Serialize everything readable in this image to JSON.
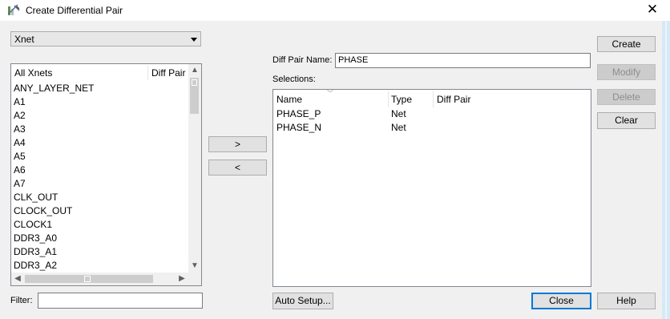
{
  "window": {
    "title": "Create Differential Pair",
    "close_glyph": "✕",
    "icon": "diff-pair-app-icon"
  },
  "net_type_select": {
    "selected": "Xnet"
  },
  "left_list": {
    "headers": [
      "All Xnets",
      "Diff Pair"
    ],
    "items": [
      "ANY_LAYER_NET",
      "A1",
      "A2",
      "A3",
      "A4",
      "A5",
      "A6",
      "A7",
      "CLK_OUT",
      "CLOCK_OUT",
      "CLOCK1",
      "DDR3_A0",
      "DDR3_A1",
      "DDR3_A2"
    ]
  },
  "move_buttons": {
    "add": ">",
    "remove": "<"
  },
  "filter": {
    "label": "Filter:",
    "value": ""
  },
  "diff_pair_name": {
    "label": "Diff Pair Name:",
    "value": "PHASE"
  },
  "selections": {
    "label": "Selections:",
    "headers": [
      "Name",
      "Type",
      "Diff Pair"
    ],
    "rows": [
      {
        "name": "PHASE_P",
        "type": "Net",
        "diff_pair": ""
      },
      {
        "name": "PHASE_N",
        "type": "Net",
        "diff_pair": ""
      }
    ]
  },
  "buttons": {
    "create": "Create",
    "modify": "Modify",
    "delete": "Delete",
    "clear": "Clear",
    "auto_setup": "Auto Setup...",
    "close": "Close",
    "help": "Help"
  },
  "colors": {
    "dialog_bg": "#f0f0f0",
    "accent": "#0078d7",
    "disabled_text": "#8d8d8d"
  }
}
